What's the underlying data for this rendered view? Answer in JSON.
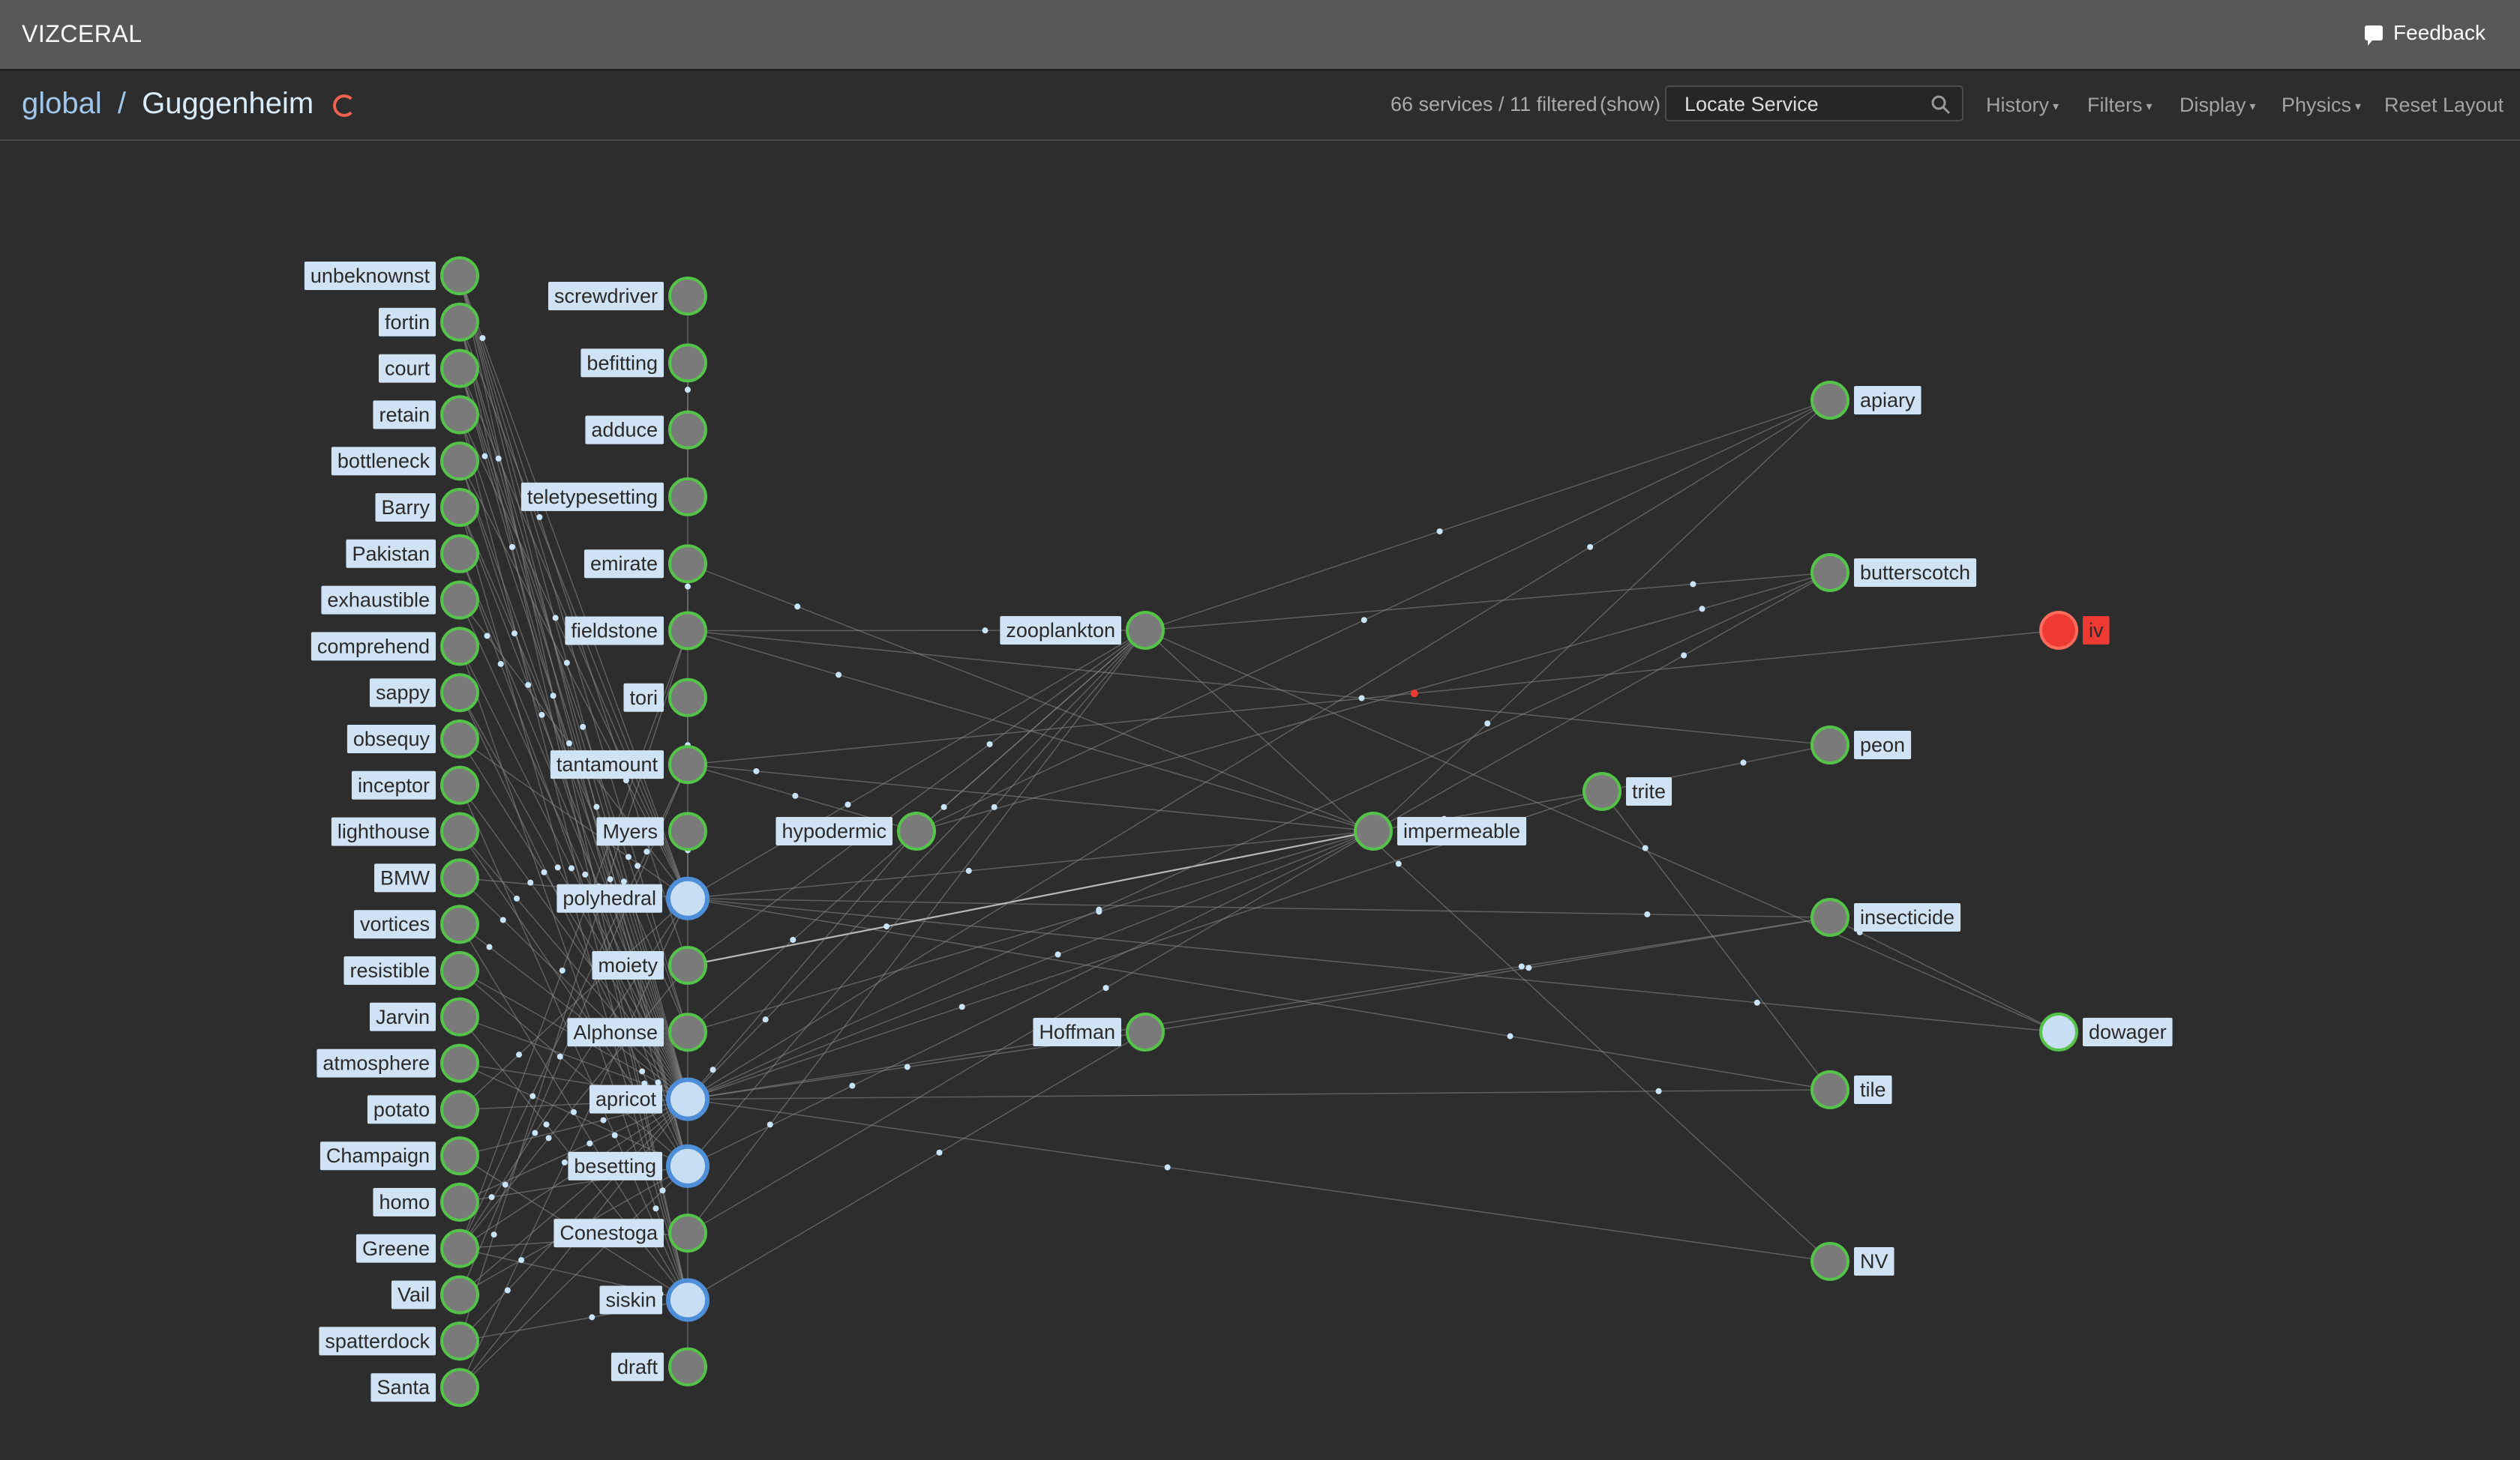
{
  "app": {
    "brand": "VIZCERAL",
    "feedback_label": "Feedback"
  },
  "breadcrumb": {
    "root": "global",
    "separator": " / ",
    "current": "Guggenheim",
    "refresh_icon": "refresh-icon"
  },
  "toolbar": {
    "service_count": "66 services / 11 filtered",
    "show_label": "(show)",
    "locate_placeholder": "Locate Service",
    "search_icon": "search-icon",
    "menus": [
      "History",
      "Filters",
      "Display",
      "Physics"
    ],
    "reset_label": "Reset Layout"
  },
  "colors": {
    "healthy_ring": "#55c24a",
    "node_fill": "#7a7a7a",
    "focused_fill": "#c7def3",
    "focused_ring": "#4f8fd9",
    "danger": "#ef3a34",
    "label_bg": "#cfe3f4",
    "edge": "#8e8e8e",
    "particle": "#c9e4fb"
  },
  "graph": {
    "nodes": [
      {
        "id": "unbeknownst",
        "label": "unbeknownst",
        "status": "normal"
      },
      {
        "id": "fortin",
        "label": "fortin",
        "status": "normal"
      },
      {
        "id": "court",
        "label": "court",
        "status": "normal"
      },
      {
        "id": "retain",
        "label": "retain",
        "status": "normal"
      },
      {
        "id": "bottleneck",
        "label": "bottleneck",
        "status": "normal"
      },
      {
        "id": "Barry",
        "label": "Barry",
        "status": "normal"
      },
      {
        "id": "Pakistan",
        "label": "Pakistan",
        "status": "normal"
      },
      {
        "id": "exhaustible",
        "label": "exhaustible",
        "status": "normal"
      },
      {
        "id": "comprehend",
        "label": "comprehend",
        "status": "normal"
      },
      {
        "id": "sappy",
        "label": "sappy",
        "status": "normal"
      },
      {
        "id": "obsequy",
        "label": "obsequy",
        "status": "normal"
      },
      {
        "id": "inceptor",
        "label": "inceptor",
        "status": "normal"
      },
      {
        "id": "lighthouse",
        "label": "lighthouse",
        "status": "normal"
      },
      {
        "id": "BMW",
        "label": "BMW",
        "status": "normal"
      },
      {
        "id": "vortices",
        "label": "vortices",
        "status": "normal"
      },
      {
        "id": "resistible",
        "label": "resistible",
        "status": "normal"
      },
      {
        "id": "Jarvin",
        "label": "Jarvin",
        "status": "normal"
      },
      {
        "id": "atmosphere",
        "label": "atmosphere",
        "status": "normal"
      },
      {
        "id": "potato",
        "label": "potato",
        "status": "normal"
      },
      {
        "id": "Champaign",
        "label": "Champaign",
        "status": "normal"
      },
      {
        "id": "homo",
        "label": "homo",
        "status": "normal"
      },
      {
        "id": "Greene",
        "label": "Greene",
        "status": "normal"
      },
      {
        "id": "Vail",
        "label": "Vail",
        "status": "normal"
      },
      {
        "id": "spatterdock",
        "label": "spatterdock",
        "status": "normal"
      },
      {
        "id": "Santa",
        "label": "Santa",
        "status": "normal"
      },
      {
        "id": "screwdriver",
        "label": "screwdriver",
        "status": "normal"
      },
      {
        "id": "befitting",
        "label": "befitting",
        "status": "normal"
      },
      {
        "id": "adduce",
        "label": "adduce",
        "status": "normal"
      },
      {
        "id": "teletypesetting",
        "label": "teletypesetting",
        "status": "normal"
      },
      {
        "id": "emirate",
        "label": "emirate",
        "status": "normal"
      },
      {
        "id": "fieldstone",
        "label": "fieldstone",
        "status": "normal"
      },
      {
        "id": "tori",
        "label": "tori",
        "status": "normal"
      },
      {
        "id": "tantamount",
        "label": "tantamount",
        "status": "normal"
      },
      {
        "id": "Myers",
        "label": "Myers",
        "status": "normal"
      },
      {
        "id": "polyhedral",
        "label": "polyhedral",
        "status": "focused"
      },
      {
        "id": "moiety",
        "label": "moiety",
        "status": "normal"
      },
      {
        "id": "Alphonse",
        "label": "Alphonse",
        "status": "normal"
      },
      {
        "id": "apricot",
        "label": "apricot",
        "status": "focused"
      },
      {
        "id": "besetting",
        "label": "besetting",
        "status": "focused"
      },
      {
        "id": "Conestoga",
        "label": "Conestoga",
        "status": "normal"
      },
      {
        "id": "siskin",
        "label": "siskin",
        "status": "focused"
      },
      {
        "id": "draft",
        "label": "draft",
        "status": "normal"
      },
      {
        "id": "hypodermic",
        "label": "hypodermic",
        "status": "normal"
      },
      {
        "id": "zooplankton",
        "label": "zooplankton",
        "status": "normal"
      },
      {
        "id": "Hoffman",
        "label": "Hoffman",
        "status": "normal"
      },
      {
        "id": "impermeable",
        "label": "impermeable",
        "status": "normal"
      },
      {
        "id": "trite",
        "label": "trite",
        "status": "normal"
      },
      {
        "id": "apiary",
        "label": "apiary",
        "status": "normal"
      },
      {
        "id": "butterscotch",
        "label": "butterscotch",
        "status": "normal"
      },
      {
        "id": "peon",
        "label": "peon",
        "status": "normal"
      },
      {
        "id": "insecticide",
        "label": "insecticide",
        "status": "normal"
      },
      {
        "id": "tile",
        "label": "tile",
        "status": "normal"
      },
      {
        "id": "NV",
        "label": "NV",
        "status": "normal"
      },
      {
        "id": "iv",
        "label": "iv",
        "status": "danger"
      },
      {
        "id": "dowager",
        "label": "dowager",
        "status": "light"
      }
    ],
    "edges": [
      [
        "unbeknownst",
        "polyhedral"
      ],
      [
        "unbeknownst",
        "apricot"
      ],
      [
        "unbeknownst",
        "besetting"
      ],
      [
        "unbeknownst",
        "siskin"
      ],
      [
        "unbeknownst",
        "Alphonse"
      ],
      [
        "unbeknownst",
        "moiety"
      ],
      [
        "fortin",
        "apricot"
      ],
      [
        "fortin",
        "polyhedral"
      ],
      [
        "fortin",
        "besetting"
      ],
      [
        "fortin",
        "siskin"
      ],
      [
        "court",
        "apricot"
      ],
      [
        "court",
        "polyhedral"
      ],
      [
        "court",
        "Alphonse"
      ],
      [
        "court",
        "besetting"
      ],
      [
        "retain",
        "apricot"
      ],
      [
        "retain",
        "siskin"
      ],
      [
        "retain",
        "polyhedral"
      ],
      [
        "bottleneck",
        "apricot"
      ],
      [
        "bottleneck",
        "besetting"
      ],
      [
        "bottleneck",
        "polyhedral"
      ],
      [
        "Barry",
        "apricot"
      ],
      [
        "Barry",
        "siskin"
      ],
      [
        "Barry",
        "Alphonse"
      ],
      [
        "Pakistan",
        "apricot"
      ],
      [
        "Pakistan",
        "besetting"
      ],
      [
        "exhaustible",
        "apricot"
      ],
      [
        "exhaustible",
        "polyhedral"
      ],
      [
        "comprehend",
        "apricot"
      ],
      [
        "comprehend",
        "siskin"
      ],
      [
        "sappy",
        "apricot"
      ],
      [
        "sappy",
        "besetting"
      ],
      [
        "obsequy",
        "apricot"
      ],
      [
        "obsequy",
        "polyhedral"
      ],
      [
        "inceptor",
        "apricot"
      ],
      [
        "inceptor",
        "siskin"
      ],
      [
        "lighthouse",
        "apricot"
      ],
      [
        "lighthouse",
        "besetting"
      ],
      [
        "BMW",
        "apricot"
      ],
      [
        "BMW",
        "polyhedral"
      ],
      [
        "vortices",
        "apricot"
      ],
      [
        "vortices",
        "siskin"
      ],
      [
        "resistible",
        "apricot"
      ],
      [
        "resistible",
        "besetting"
      ],
      [
        "Jarvin",
        "apricot"
      ],
      [
        "Jarvin",
        "siskin"
      ],
      [
        "atmosphere",
        "apricot"
      ],
      [
        "atmosphere",
        "besetting"
      ],
      [
        "potato",
        "apricot"
      ],
      [
        "potato",
        "polyhedral"
      ],
      [
        "Champaign",
        "apricot"
      ],
      [
        "Champaign",
        "siskin"
      ],
      [
        "homo",
        "apricot"
      ],
      [
        "homo",
        "besetting"
      ],
      [
        "Greene",
        "apricot"
      ],
      [
        "Greene",
        "siskin"
      ],
      [
        "Greene",
        "fieldstone"
      ],
      [
        "Greene",
        "tantamount"
      ],
      [
        "Greene",
        "moiety"
      ],
      [
        "Greene",
        "Conestoga"
      ],
      [
        "Greene",
        "polyhedral"
      ],
      [
        "Vail",
        "apricot"
      ],
      [
        "Vail",
        "besetting"
      ],
      [
        "Vail",
        "tantamount"
      ],
      [
        "spatterdock",
        "apricot"
      ],
      [
        "spatterdock",
        "siskin"
      ],
      [
        "spatterdock",
        "fieldstone"
      ],
      [
        "Santa",
        "apricot"
      ],
      [
        "Santa",
        "besetting"
      ],
      [
        "Santa",
        "polyhedral"
      ],
      [
        "screwdriver",
        "draft"
      ],
      [
        "befitting",
        "adduce"
      ],
      [
        "adduce",
        "teletypesetting"
      ],
      [
        "emirate",
        "fieldstone"
      ],
      [
        "tori",
        "tantamount"
      ],
      [
        "Myers",
        "polyhedral"
      ],
      [
        "fieldstone",
        "zooplankton"
      ],
      [
        "fieldstone",
        "impermeable"
      ],
      [
        "fieldstone",
        "peon"
      ],
      [
        "emirate",
        "impermeable"
      ],
      [
        "tantamount",
        "iv"
      ],
      [
        "tantamount",
        "impermeable"
      ],
      [
        "tantamount",
        "hypodermic"
      ],
      [
        "polyhedral",
        "insecticide"
      ],
      [
        "polyhedral",
        "impermeable"
      ],
      [
        "polyhedral",
        "dowager"
      ],
      [
        "polyhedral",
        "zooplankton"
      ],
      [
        "polyhedral",
        "tile"
      ],
      [
        "moiety",
        "impermeable"
      ],
      [
        "moiety",
        "zooplankton"
      ],
      [
        "Alphonse",
        "zooplankton"
      ],
      [
        "Alphonse",
        "impermeable"
      ],
      [
        "apricot",
        "zooplankton"
      ],
      [
        "apricot",
        "impermeable"
      ],
      [
        "apricot",
        "hypodermic"
      ],
      [
        "apricot",
        "Hoffman"
      ],
      [
        "apricot",
        "tile"
      ],
      [
        "apricot",
        "NV"
      ],
      [
        "apricot",
        "apiary"
      ],
      [
        "apricot",
        "butterscotch"
      ],
      [
        "apricot",
        "insecticide"
      ],
      [
        "apricot",
        "trite"
      ],
      [
        "besetting",
        "zooplankton"
      ],
      [
        "besetting",
        "impermeable"
      ],
      [
        "Conestoga",
        "impermeable"
      ],
      [
        "Conestoga",
        "zooplankton"
      ],
      [
        "siskin",
        "Hoffman"
      ],
      [
        "hypodermic",
        "zooplankton"
      ],
      [
        "hypodermic",
        "apiary"
      ],
      [
        "hypodermic",
        "butterscotch"
      ],
      [
        "zooplankton",
        "apiary"
      ],
      [
        "zooplankton",
        "butterscotch"
      ],
      [
        "zooplankton",
        "NV"
      ],
      [
        "zooplankton",
        "dowager"
      ],
      [
        "impermeable",
        "trite"
      ],
      [
        "impermeable",
        "butterscotch"
      ],
      [
        "impermeable",
        "apiary"
      ],
      [
        "trite",
        "peon"
      ],
      [
        "trite",
        "tile"
      ],
      [
        "Hoffman",
        "insecticide"
      ],
      [
        "insecticide",
        "dowager"
      ]
    ]
  }
}
